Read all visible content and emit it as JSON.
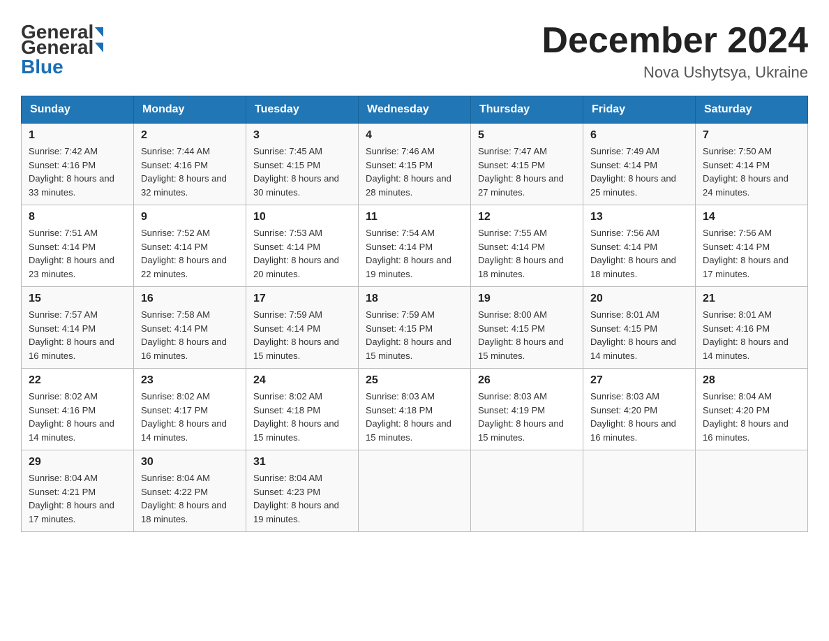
{
  "header": {
    "logo": {
      "general": "General",
      "blue": "Blue"
    },
    "title": "December 2024",
    "location": "Nova Ushytsya, Ukraine"
  },
  "days_of_week": [
    "Sunday",
    "Monday",
    "Tuesday",
    "Wednesday",
    "Thursday",
    "Friday",
    "Saturday"
  ],
  "weeks": [
    [
      {
        "day": "1",
        "sunrise": "7:42 AM",
        "sunset": "4:16 PM",
        "daylight": "8 hours and 33 minutes."
      },
      {
        "day": "2",
        "sunrise": "7:44 AM",
        "sunset": "4:16 PM",
        "daylight": "8 hours and 32 minutes."
      },
      {
        "day": "3",
        "sunrise": "7:45 AM",
        "sunset": "4:15 PM",
        "daylight": "8 hours and 30 minutes."
      },
      {
        "day": "4",
        "sunrise": "7:46 AM",
        "sunset": "4:15 PM",
        "daylight": "8 hours and 28 minutes."
      },
      {
        "day": "5",
        "sunrise": "7:47 AM",
        "sunset": "4:15 PM",
        "daylight": "8 hours and 27 minutes."
      },
      {
        "day": "6",
        "sunrise": "7:49 AM",
        "sunset": "4:14 PM",
        "daylight": "8 hours and 25 minutes."
      },
      {
        "day": "7",
        "sunrise": "7:50 AM",
        "sunset": "4:14 PM",
        "daylight": "8 hours and 24 minutes."
      }
    ],
    [
      {
        "day": "8",
        "sunrise": "7:51 AM",
        "sunset": "4:14 PM",
        "daylight": "8 hours and 23 minutes."
      },
      {
        "day": "9",
        "sunrise": "7:52 AM",
        "sunset": "4:14 PM",
        "daylight": "8 hours and 22 minutes."
      },
      {
        "day": "10",
        "sunrise": "7:53 AM",
        "sunset": "4:14 PM",
        "daylight": "8 hours and 20 minutes."
      },
      {
        "day": "11",
        "sunrise": "7:54 AM",
        "sunset": "4:14 PM",
        "daylight": "8 hours and 19 minutes."
      },
      {
        "day": "12",
        "sunrise": "7:55 AM",
        "sunset": "4:14 PM",
        "daylight": "8 hours and 18 minutes."
      },
      {
        "day": "13",
        "sunrise": "7:56 AM",
        "sunset": "4:14 PM",
        "daylight": "8 hours and 18 minutes."
      },
      {
        "day": "14",
        "sunrise": "7:56 AM",
        "sunset": "4:14 PM",
        "daylight": "8 hours and 17 minutes."
      }
    ],
    [
      {
        "day": "15",
        "sunrise": "7:57 AM",
        "sunset": "4:14 PM",
        "daylight": "8 hours and 16 minutes."
      },
      {
        "day": "16",
        "sunrise": "7:58 AM",
        "sunset": "4:14 PM",
        "daylight": "8 hours and 16 minutes."
      },
      {
        "day": "17",
        "sunrise": "7:59 AM",
        "sunset": "4:14 PM",
        "daylight": "8 hours and 15 minutes."
      },
      {
        "day": "18",
        "sunrise": "7:59 AM",
        "sunset": "4:15 PM",
        "daylight": "8 hours and 15 minutes."
      },
      {
        "day": "19",
        "sunrise": "8:00 AM",
        "sunset": "4:15 PM",
        "daylight": "8 hours and 15 minutes."
      },
      {
        "day": "20",
        "sunrise": "8:01 AM",
        "sunset": "4:15 PM",
        "daylight": "8 hours and 14 minutes."
      },
      {
        "day": "21",
        "sunrise": "8:01 AM",
        "sunset": "4:16 PM",
        "daylight": "8 hours and 14 minutes."
      }
    ],
    [
      {
        "day": "22",
        "sunrise": "8:02 AM",
        "sunset": "4:16 PM",
        "daylight": "8 hours and 14 minutes."
      },
      {
        "day": "23",
        "sunrise": "8:02 AM",
        "sunset": "4:17 PM",
        "daylight": "8 hours and 14 minutes."
      },
      {
        "day": "24",
        "sunrise": "8:02 AM",
        "sunset": "4:18 PM",
        "daylight": "8 hours and 15 minutes."
      },
      {
        "day": "25",
        "sunrise": "8:03 AM",
        "sunset": "4:18 PM",
        "daylight": "8 hours and 15 minutes."
      },
      {
        "day": "26",
        "sunrise": "8:03 AM",
        "sunset": "4:19 PM",
        "daylight": "8 hours and 15 minutes."
      },
      {
        "day": "27",
        "sunrise": "8:03 AM",
        "sunset": "4:20 PM",
        "daylight": "8 hours and 16 minutes."
      },
      {
        "day": "28",
        "sunrise": "8:04 AM",
        "sunset": "4:20 PM",
        "daylight": "8 hours and 16 minutes."
      }
    ],
    [
      {
        "day": "29",
        "sunrise": "8:04 AM",
        "sunset": "4:21 PM",
        "daylight": "8 hours and 17 minutes."
      },
      {
        "day": "30",
        "sunrise": "8:04 AM",
        "sunset": "4:22 PM",
        "daylight": "8 hours and 18 minutes."
      },
      {
        "day": "31",
        "sunrise": "8:04 AM",
        "sunset": "4:23 PM",
        "daylight": "8 hours and 19 minutes."
      },
      null,
      null,
      null,
      null
    ]
  ]
}
